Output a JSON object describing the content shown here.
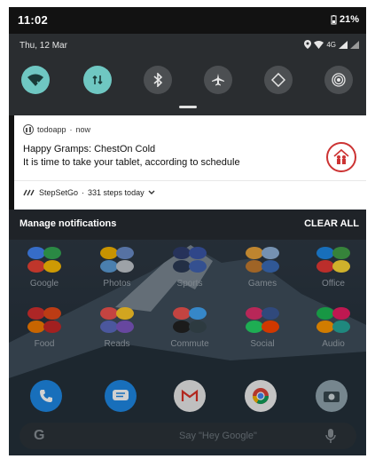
{
  "statusbar": {
    "time": "11:02",
    "battery": "21%"
  },
  "quick_settings": {
    "date": "Thu, 12 Mar",
    "network": "4G",
    "tiles": [
      {
        "name": "wifi",
        "state": "on"
      },
      {
        "name": "data",
        "state": "on"
      },
      {
        "name": "bluetooth",
        "state": "off"
      },
      {
        "name": "airplane",
        "state": "off"
      },
      {
        "name": "auto-rotate",
        "state": "off"
      },
      {
        "name": "hotspot",
        "state": "off"
      }
    ]
  },
  "notification": {
    "app": "todoapp",
    "time": "now",
    "title": "Happy Gramps: ChestOn Cold",
    "text": "It is time to take your tablet, according to schedule",
    "secondary_app": "StepSetGo",
    "secondary_text": "331 steps today"
  },
  "notification_footer": {
    "manage": "Manage notifications",
    "clear_all": "CLEAR ALL"
  },
  "home_folders_row1": [
    "Google",
    "Photos",
    "Sports",
    "Games",
    "Office"
  ],
  "home_folders_row2": [
    "Food",
    "Reads",
    "Commute",
    "Social",
    "Audio"
  ],
  "search": {
    "placeholder": "Say \"Hey Google\"",
    "logo": "G"
  },
  "colors": {
    "accent_tile": "#6fc7c2",
    "notification_bg": "#ffffff",
    "panel_bg": "#2a2d30"
  }
}
